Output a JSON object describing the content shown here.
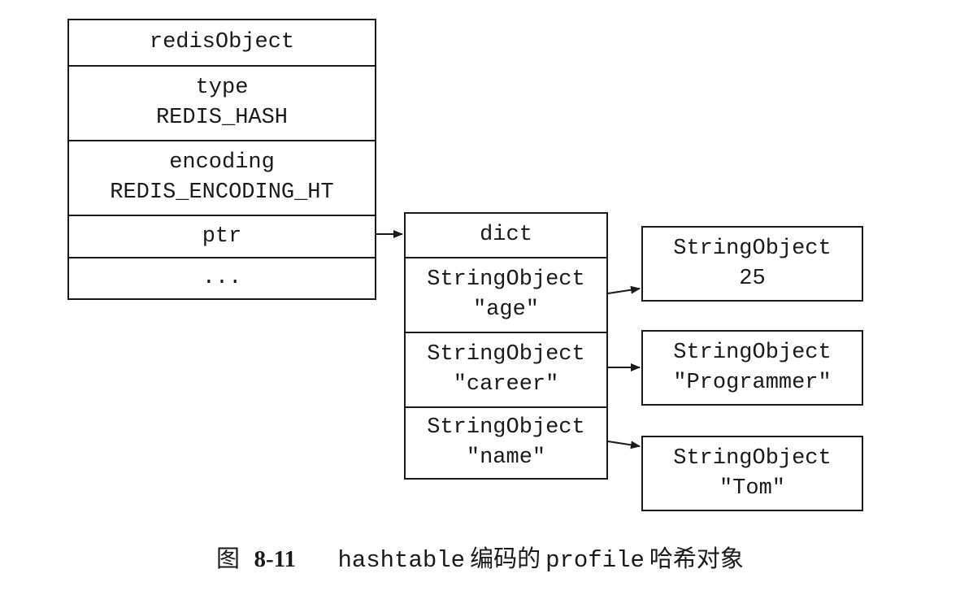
{
  "redis_object": {
    "header": "redisObject",
    "type_label": "type",
    "type_value": "REDIS_HASH",
    "encoding_label": "encoding",
    "encoding_value": "REDIS_ENCODING_HT",
    "ptr_label": "ptr",
    "ellipsis": "..."
  },
  "dict": {
    "header": "dict",
    "entries": [
      {
        "key_type": "StringObject",
        "key": "\"age\"",
        "value_type": "StringObject",
        "value": "25"
      },
      {
        "key_type": "StringObject",
        "key": "\"career\"",
        "value_type": "StringObject",
        "value": "\"Programmer\""
      },
      {
        "key_type": "StringObject",
        "key": "\"name\"",
        "value_type": "StringObject",
        "value": "\"Tom\""
      }
    ]
  },
  "caption": {
    "figure_label": "图",
    "figure_number": "8-11",
    "encoding_name": "hashtable",
    "text_middle": "编码的",
    "object_name": "profile",
    "text_end": "哈希对象"
  }
}
